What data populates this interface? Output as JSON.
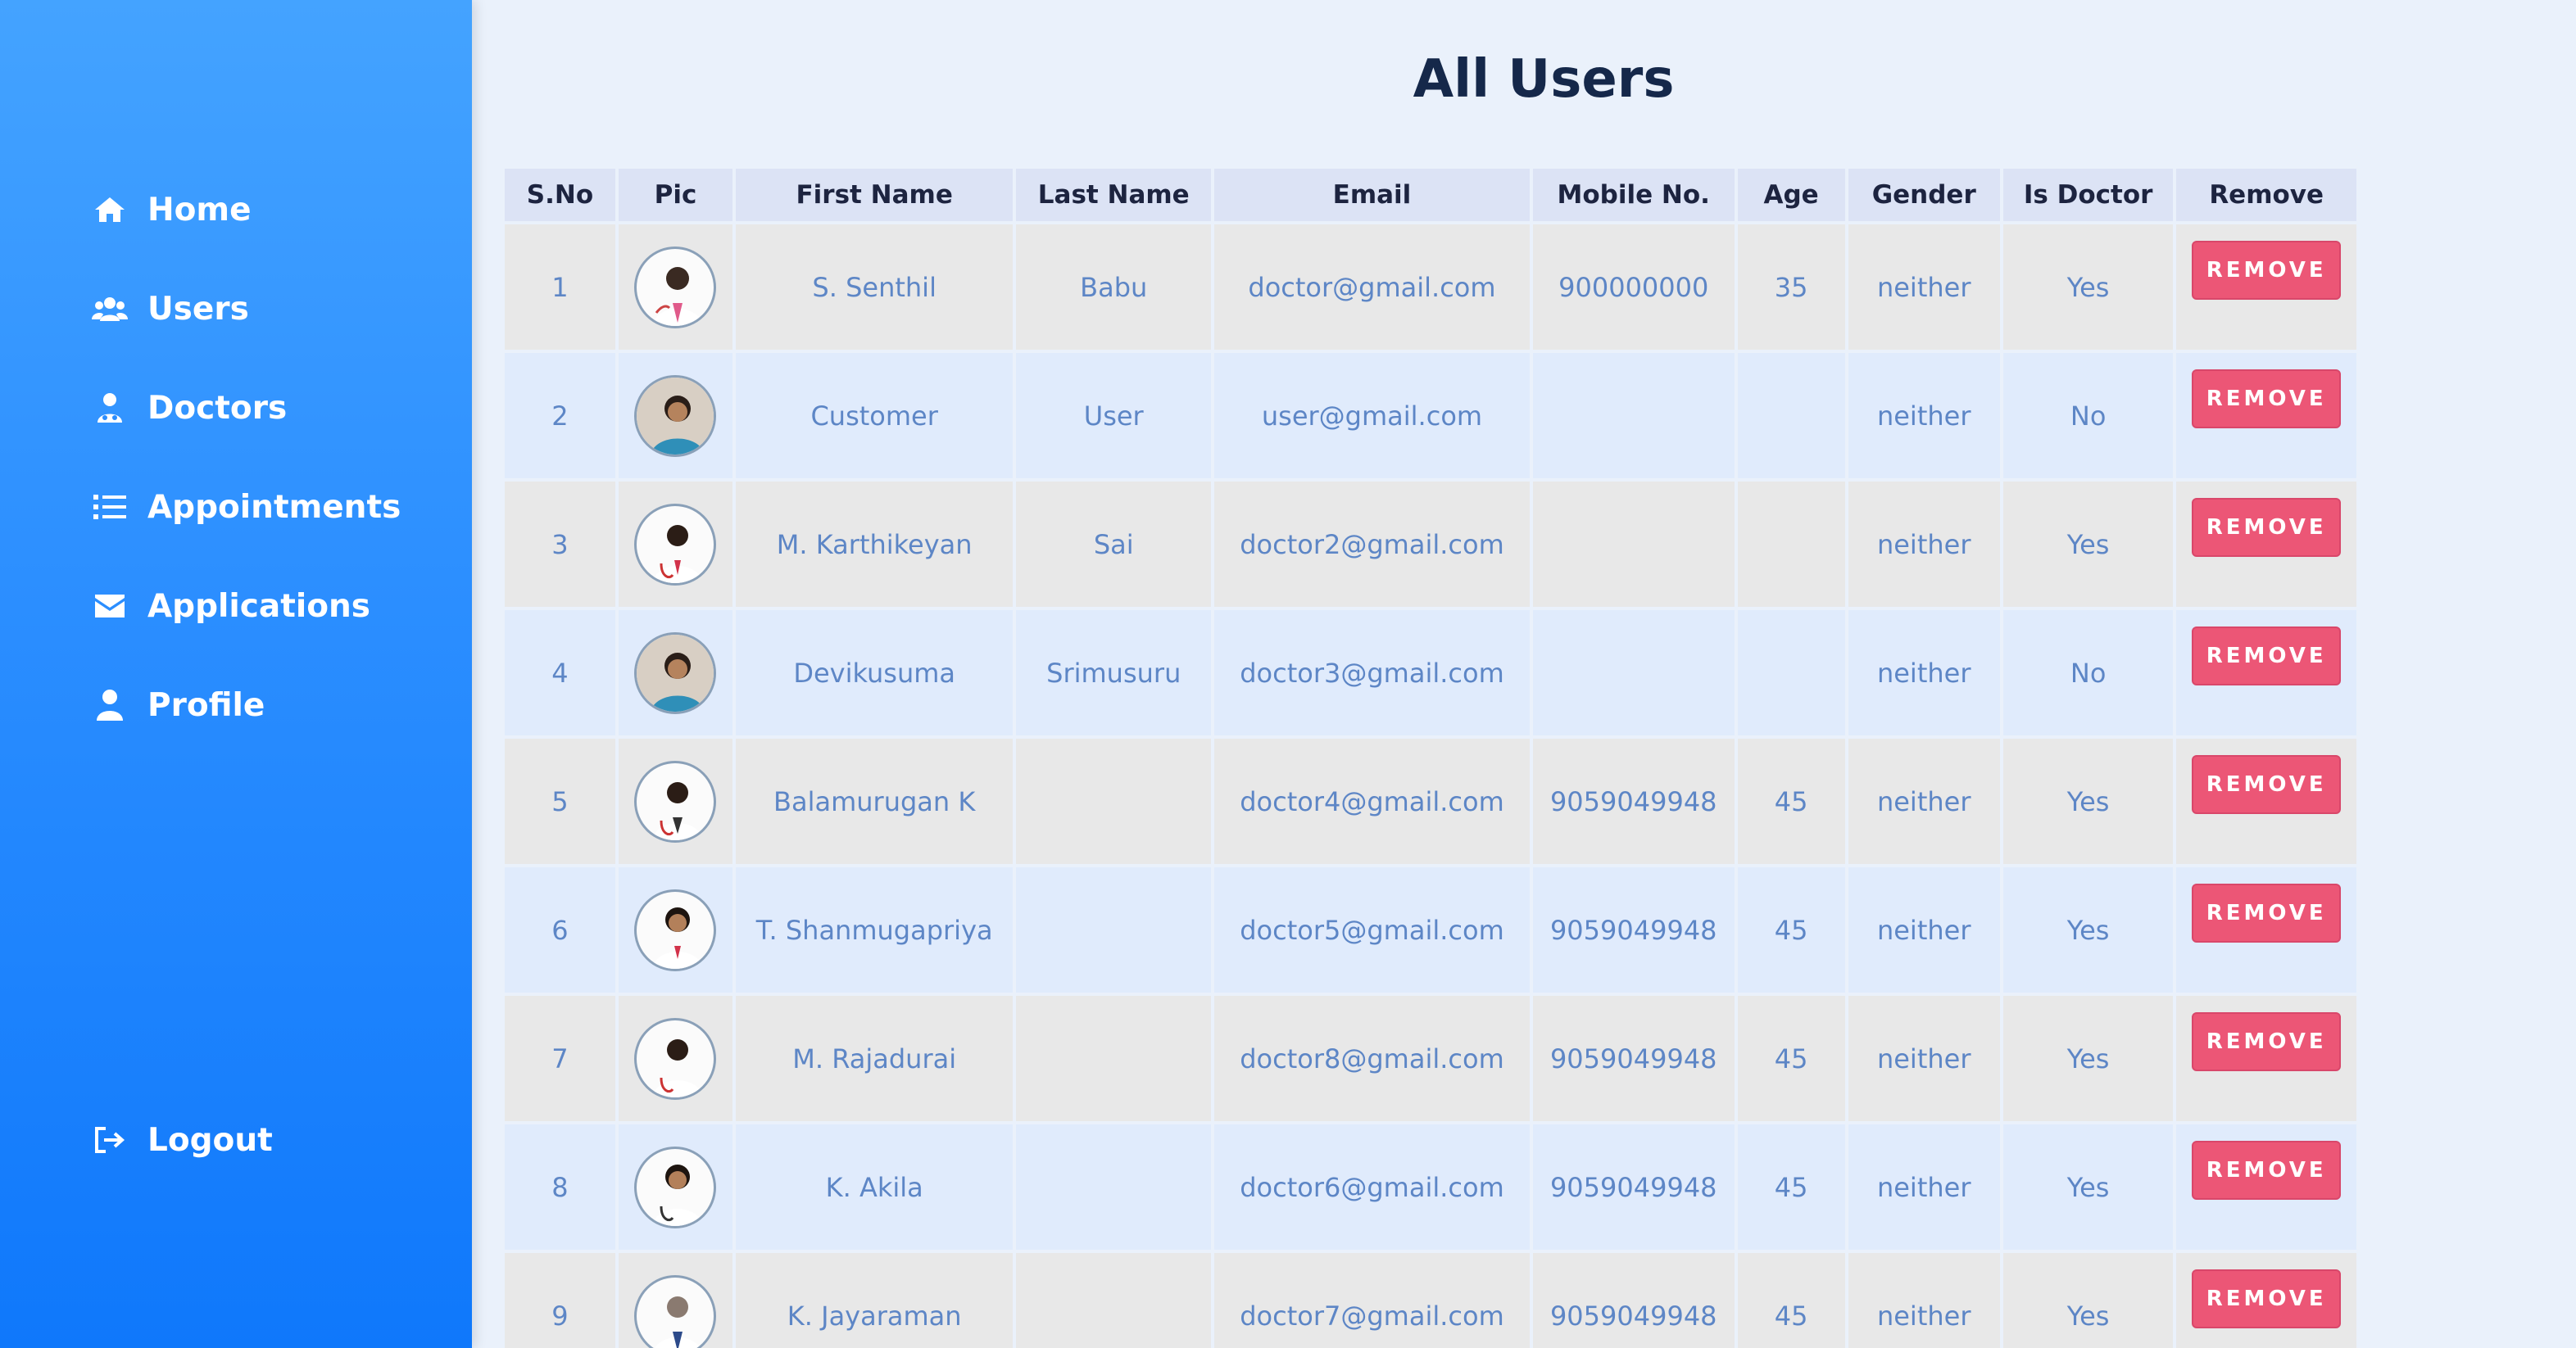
{
  "sidebar": {
    "items": [
      {
        "label": "Home",
        "icon": "home-icon"
      },
      {
        "label": "Users",
        "icon": "users-icon"
      },
      {
        "label": "Doctors",
        "icon": "doctor-icon"
      },
      {
        "label": "Appointments",
        "icon": "list-icon"
      },
      {
        "label": "Applications",
        "icon": "envelope-icon"
      },
      {
        "label": "Profile",
        "icon": "user-icon"
      }
    ],
    "logout": {
      "label": "Logout",
      "icon": "sign-out-icon"
    }
  },
  "page": {
    "title": "All Users"
  },
  "table": {
    "columns": [
      "S.No",
      "Pic",
      "First Name",
      "Last Name",
      "Email",
      "Mobile No.",
      "Age",
      "Gender",
      "Is Doctor",
      "Remove"
    ],
    "remove_label": "REMOVE",
    "rows": [
      {
        "sno": "1",
        "first": "S. Senthil",
        "last": "Babu",
        "email": "doctor@gmail.com",
        "mobile": "900000000",
        "age": "35",
        "gender": "neither",
        "is_doctor": "Yes"
      },
      {
        "sno": "2",
        "first": "Customer",
        "last": "User",
        "email": "user@gmail.com",
        "mobile": "",
        "age": "",
        "gender": "neither",
        "is_doctor": "No"
      },
      {
        "sno": "3",
        "first": "M. Karthikeyan",
        "last": "Sai",
        "email": "doctor2@gmail.com",
        "mobile": "",
        "age": "",
        "gender": "neither",
        "is_doctor": "Yes"
      },
      {
        "sno": "4",
        "first": "Devikusuma",
        "last": "Srimusuru",
        "email": "doctor3@gmail.com",
        "mobile": "",
        "age": "",
        "gender": "neither",
        "is_doctor": "No"
      },
      {
        "sno": "5",
        "first": "Balamurugan K",
        "last": "",
        "email": "doctor4@gmail.com",
        "mobile": "9059049948",
        "age": "45",
        "gender": "neither",
        "is_doctor": "Yes"
      },
      {
        "sno": "6",
        "first": "T. Shanmugapriya",
        "last": "",
        "email": "doctor5@gmail.com",
        "mobile": "9059049948",
        "age": "45",
        "gender": "neither",
        "is_doctor": "Yes"
      },
      {
        "sno": "7",
        "first": "M. Rajadurai",
        "last": "",
        "email": "doctor8@gmail.com",
        "mobile": "9059049948",
        "age": "45",
        "gender": "neither",
        "is_doctor": "Yes"
      },
      {
        "sno": "8",
        "first": "K. Akila",
        "last": "",
        "email": "doctor6@gmail.com",
        "mobile": "9059049948",
        "age": "45",
        "gender": "neither",
        "is_doctor": "Yes"
      },
      {
        "sno": "9",
        "first": "K. Jayaraman",
        "last": "",
        "email": "doctor7@gmail.com",
        "mobile": "9059049948",
        "age": "45",
        "gender": "neither",
        "is_doctor": "Yes"
      }
    ]
  },
  "colors": {
    "sidebar_top": "#44a3ff",
    "sidebar_bottom": "#0f78fb",
    "background": "#eaf1fb",
    "title": "#15284a",
    "header_bg": "#dce3f5",
    "row_odd": "#e8e8e8",
    "row_even": "#e0ebfc",
    "cell_text": "#5d86c6",
    "remove_button": "#ec5676"
  }
}
